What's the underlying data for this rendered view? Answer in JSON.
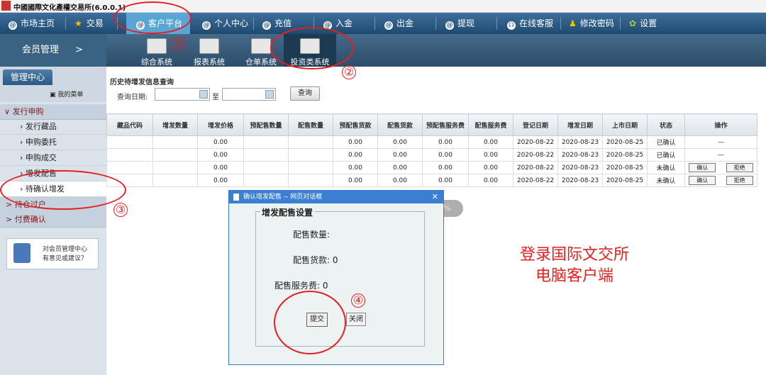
{
  "window": {
    "title": "中國國際文化產權交易所(6.0.0.1)"
  },
  "nav": {
    "items": [
      {
        "label": "市场主页",
        "icon": "globe-icon"
      },
      {
        "label": "交易",
        "icon": "star-icon"
      },
      {
        "label": "客户平台",
        "icon": "at-icon",
        "active": true
      },
      {
        "label": "个人中心",
        "icon": "at-icon"
      },
      {
        "label": "充值",
        "icon": "at-icon"
      },
      {
        "label": "入金",
        "icon": "at-icon"
      },
      {
        "label": "出金",
        "icon": "at-icon"
      },
      {
        "label": "提现",
        "icon": "at-icon"
      },
      {
        "label": "在线客服",
        "icon": "headset-icon"
      },
      {
        "label": "修改密码",
        "icon": "person-icon"
      },
      {
        "label": "设置",
        "icon": "gear-icon"
      }
    ]
  },
  "subnav": {
    "section": "会员管理",
    "arrow": ">",
    "items": [
      {
        "label": "综合系统"
      },
      {
        "label": "报表系统"
      },
      {
        "label": "仓单系统"
      },
      {
        "label": "投资类系统",
        "active": true
      }
    ]
  },
  "sidebar": {
    "tab": "管理中心",
    "my_menu": "我的菜单",
    "groups": [
      {
        "label": "发行申购",
        "arrow": "∨"
      },
      {
        "label": "持仓过户",
        "arrow": ">"
      },
      {
        "label": "付费确认",
        "arrow": ">"
      }
    ],
    "items": [
      {
        "label": "发行藏品"
      },
      {
        "label": "申购委托"
      },
      {
        "label": "申购成交"
      },
      {
        "label": "增发配售"
      },
      {
        "label": "待确认增发",
        "selected": true
      }
    ],
    "suggest_line1": "对会员管理中心",
    "suggest_line2": "有意见或建议？"
  },
  "query": {
    "section_title": "历史待增发信息查询",
    "date_label": "查询日期:",
    "to_label": "至",
    "query_button": "查询"
  },
  "table": {
    "headers": [
      "藏品代码",
      "增发数量",
      "增发价格",
      "预配售数量",
      "配售数量",
      "预配售货款",
      "配售货款",
      "预配售服务费",
      "配售服务费",
      "登记日期",
      "增发日期",
      "上市日期",
      "状态",
      "操作"
    ],
    "rows": [
      {
        "price": "0.00",
        "pre_payment": "0.00",
        "payment": "0.00",
        "pre_fee": "0.00",
        "fee": "0.00",
        "reg_date": "2020-08-22",
        "issue_date": "2020-08-23",
        "list_date": "2020-08-25",
        "status": "已确认",
        "op": "—"
      },
      {
        "price": "0.00",
        "pre_payment": "0.00",
        "payment": "0.00",
        "pre_fee": "0.00",
        "fee": "0.00",
        "reg_date": "2020-08-22",
        "issue_date": "2020-08-23",
        "list_date": "2020-08-25",
        "status": "已确认",
        "op": "—"
      },
      {
        "price": "0.00",
        "pre_payment": "0.00",
        "payment": "0.00",
        "pre_fee": "0.00",
        "fee": "0.00",
        "reg_date": "2020-08-22",
        "issue_date": "2020-08-23",
        "list_date": "2020-08-25",
        "status": "未确认",
        "confirm": "确认",
        "reject": "拒绝"
      },
      {
        "price": "0.00",
        "pre_payment": "0.00",
        "payment": "0.00",
        "pre_fee": "0.00",
        "fee": "0.00",
        "reg_date": "2020-08-22",
        "issue_date": "2020-08-23",
        "list_date": "2020-08-25",
        "status": "未确认",
        "confirm": "确认",
        "reject": "拒绝"
      }
    ]
  },
  "zoom": "100%",
  "dialog": {
    "title": "确认增发配售 -- 网页对话框",
    "close": "✕",
    "legend": "增发配售设置",
    "qty_label": "配售数量:",
    "payment_label": "配售货款:",
    "payment_value": "0",
    "fee_label": "配售服务费:",
    "fee_value": "0",
    "submit": "提交",
    "close_button": "关闭"
  },
  "annotations": {
    "n1": "①",
    "n2": "②",
    "n3": "③",
    "n4": "④",
    "caption_line1": "登录国际文交所",
    "caption_line2": "电脑客户端",
    "color": "#e41f1f"
  }
}
